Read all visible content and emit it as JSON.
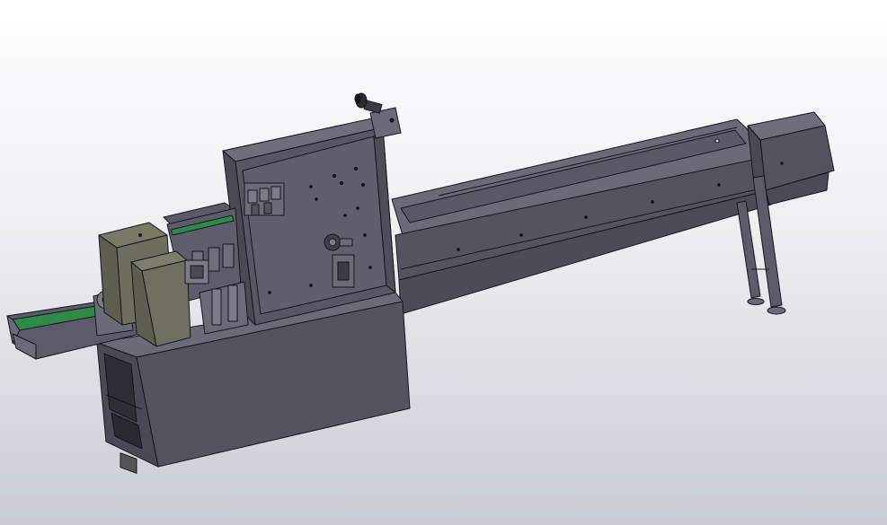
{
  "viewport": {
    "background_top": "#ffffff",
    "background_bottom": "#c9ccd4"
  },
  "model": {
    "body_color": "#545461",
    "body_light": "#6a6b79",
    "body_dark": "#3f3f4a",
    "edge_color": "#15161c",
    "belt_color": "#2f8a4a",
    "icon": "cad-part-icon"
  }
}
